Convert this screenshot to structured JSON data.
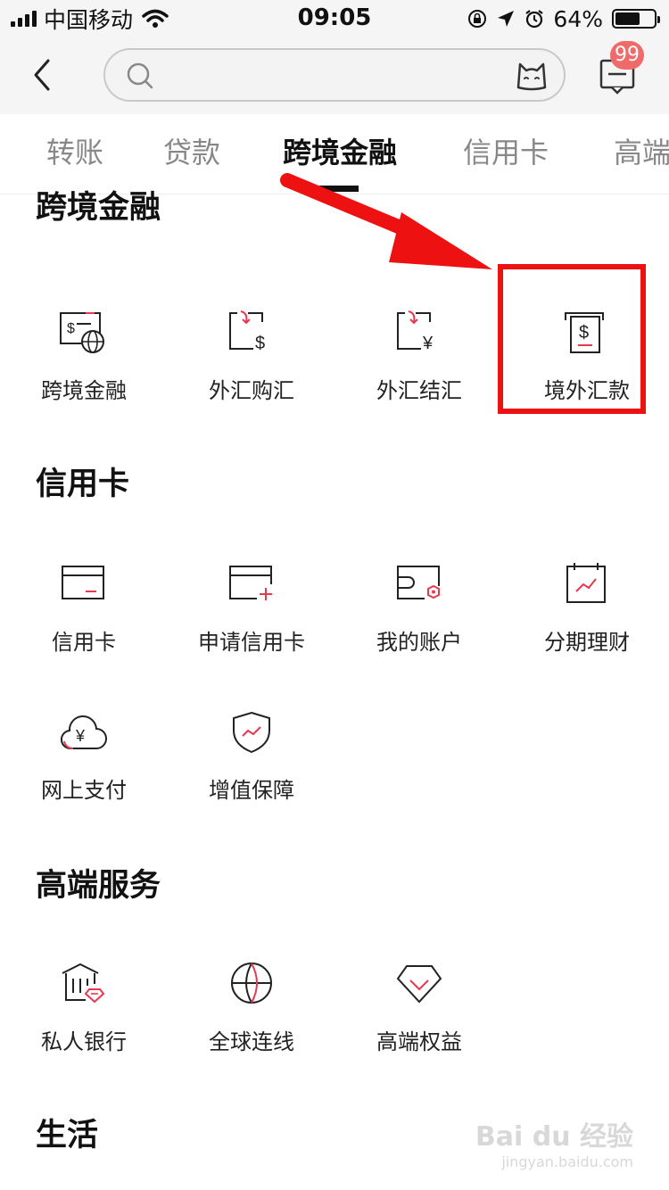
{
  "status_bar": {
    "carrier": "中国移动",
    "time": "09:05",
    "battery": "64%",
    "battery_level": 0.64
  },
  "header": {
    "back_icon": "chevron-left-icon",
    "search_placeholder": "",
    "assistant_icon": "cat-face-icon",
    "message_icon": "message-icon",
    "message_badge": "99"
  },
  "tabs": [
    "转账",
    "贷款",
    "跨境金融",
    "信用卡",
    "高端"
  ],
  "active_tab": "跨境金融",
  "sections": {
    "cross_border": {
      "title": "跨境金融",
      "items": [
        "跨境金融",
        "外汇购汇",
        "外汇结汇",
        "境外汇款"
      ]
    },
    "credit_card": {
      "title": "信用卡",
      "items": [
        "信用卡",
        "申请信用卡",
        "我的账户",
        "分期理财",
        "网上支付",
        "增值保障"
      ]
    },
    "premium": {
      "title": "高端服务",
      "items": [
        "私人银行",
        "全球连线",
        "高端权益"
      ]
    },
    "life": {
      "title": "生活"
    }
  },
  "colors": {
    "accent": "#e8384f",
    "annotation": "#ee1111",
    "badge": "#f06a6a"
  },
  "watermark": {
    "main": "Bai du 经验",
    "sub": "jingyan.baidu.com"
  }
}
